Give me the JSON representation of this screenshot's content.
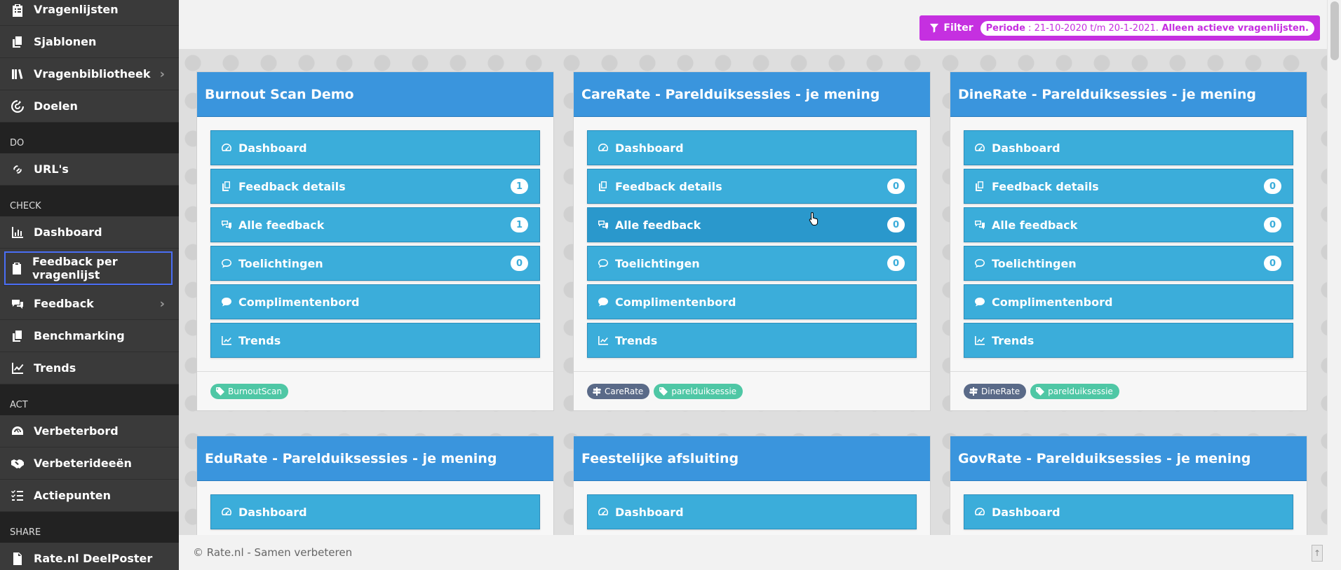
{
  "sidebar": {
    "items_top": [
      {
        "label": "Vragenlijsten",
        "icon": "clipboard-list-icon"
      },
      {
        "label": "Sjablonen",
        "icon": "copy-icon"
      },
      {
        "label": "Vragenbibliotheek",
        "icon": "book-library-icon"
      },
      {
        "label": "Doelen",
        "icon": "target-icon"
      }
    ],
    "section_do": "DO",
    "items_do": [
      {
        "label": "URL's",
        "icon": "link-icon"
      }
    ],
    "section_check": "CHECK",
    "items_check": [
      {
        "label": "Dashboard",
        "icon": "chart-icon"
      },
      {
        "label": "Feedback per vragenlijst",
        "icon": "clipboard-icon"
      },
      {
        "label": "Feedback",
        "icon": "comments-icon"
      },
      {
        "label": "Benchmarking",
        "icon": "copy-icon"
      },
      {
        "label": "Trends",
        "icon": "line-chart-icon"
      }
    ],
    "section_act": "ACT",
    "items_act": [
      {
        "label": "Verbeterbord",
        "icon": "dashboard-icon"
      },
      {
        "label": "Verbeterideeën",
        "icon": "handshake-icon"
      },
      {
        "label": "Actiepunten",
        "icon": "list-check-icon"
      }
    ],
    "section_share": "SHARE",
    "items_share": [
      {
        "label": "Rate.nl DeelPoster",
        "icon": "pdf-icon"
      }
    ]
  },
  "filter": {
    "label": "Filter",
    "periode_label": "Periode",
    "periode_value": " : 21-10-2020 t/m 20-1-2021.",
    "active_note": " Alleen actieve vragenlijsten."
  },
  "cards": [
    {
      "title": "Burnout Scan Demo",
      "rows": [
        {
          "label": "Dashboard",
          "badge": ""
        },
        {
          "label": "Feedback details",
          "badge": "1"
        },
        {
          "label": "Alle feedback",
          "badge": "1"
        },
        {
          "label": "Toelichtingen",
          "badge": "0"
        },
        {
          "label": "Complimentenbord",
          "badge": ""
        },
        {
          "label": "Trends",
          "badge": ""
        }
      ],
      "tags": [
        {
          "label": "BurnoutScan",
          "kind": "green"
        }
      ]
    },
    {
      "title": "CareRate - Parelduiksessies - je mening",
      "rows": [
        {
          "label": "Dashboard",
          "badge": ""
        },
        {
          "label": "Feedback details",
          "badge": "0"
        },
        {
          "label": "Alle feedback",
          "badge": "0"
        },
        {
          "label": "Toelichtingen",
          "badge": "0"
        },
        {
          "label": "Complimentenbord",
          "badge": ""
        },
        {
          "label": "Trends",
          "badge": ""
        }
      ],
      "tags": [
        {
          "label": "CareRate",
          "kind": "gray"
        },
        {
          "label": "parelduiksessie",
          "kind": "green"
        }
      ]
    },
    {
      "title": "DineRate - Parelduiksessies - je mening",
      "rows": [
        {
          "label": "Dashboard",
          "badge": ""
        },
        {
          "label": "Feedback details",
          "badge": "0"
        },
        {
          "label": "Alle feedback",
          "badge": "0"
        },
        {
          "label": "Toelichtingen",
          "badge": "0"
        },
        {
          "label": "Complimentenbord",
          "badge": ""
        },
        {
          "label": "Trends",
          "badge": ""
        }
      ],
      "tags": [
        {
          "label": "DineRate",
          "kind": "gray"
        },
        {
          "label": "parelduiksessie",
          "kind": "green"
        }
      ]
    },
    {
      "title": "EduRate - Parelduiksessies - je mening",
      "rows": [
        {
          "label": "Dashboard",
          "badge": ""
        }
      ],
      "tags": []
    },
    {
      "title": "Feestelijke afsluiting",
      "rows": [
        {
          "label": "Dashboard",
          "badge": ""
        }
      ],
      "tags": []
    },
    {
      "title": "GovRate - Parelduiksessies - je mening",
      "rows": [
        {
          "label": "Dashboard",
          "badge": ""
        }
      ],
      "tags": []
    }
  ],
  "footer": {
    "text": "© Rate.nl - Samen verbeteren"
  },
  "colors": {
    "sidebar_bg": "#3a3a3a",
    "header_blue": "#3a95dd",
    "row_blue": "#3badda",
    "filter_magenta": "#c530e0",
    "tag_green": "#4fc7a5",
    "tag_gray": "#5a6a88",
    "active_outline": "#4a6ef5"
  }
}
